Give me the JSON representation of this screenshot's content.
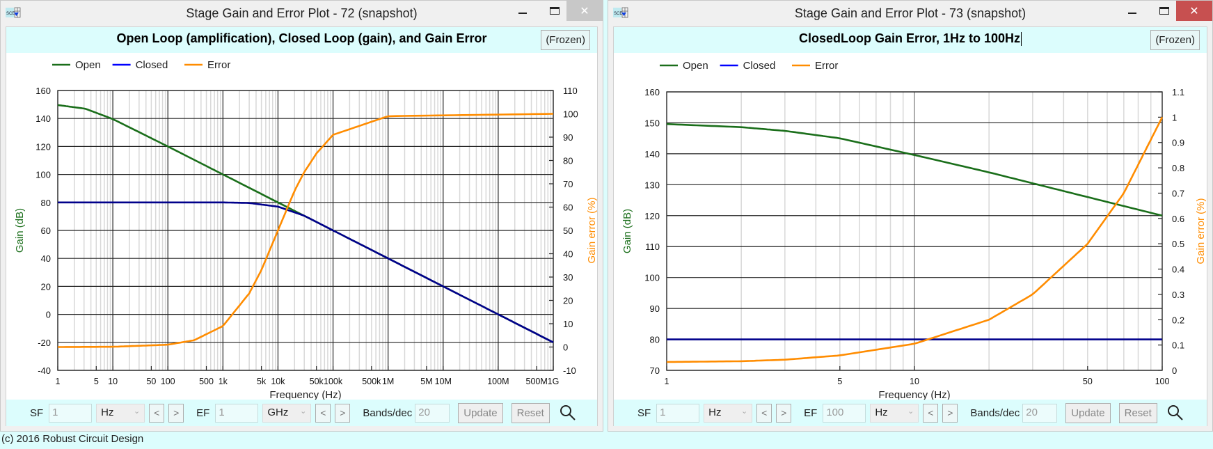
{
  "footer": "(c) 2016 Robust Circuit Design",
  "colors": {
    "open": "#1a6e1a",
    "closed": "#00008b",
    "error": "#ff8c00",
    "legend_closed": "#0000ff",
    "header_bg": "#dcfdfd"
  },
  "windows": [
    {
      "title": "Stage Gain and Error Plot - 72  (snapshot)",
      "chart_title": "Open Loop (amplification), Closed Loop (gain), and Gain Error",
      "frozen_label": "(Frozen)",
      "controls": {
        "sf_label": "SF",
        "sf_value": "1",
        "sf_unit": "Hz",
        "ef_label": "EF",
        "ef_value": "1",
        "ef_unit": "GHz",
        "prev": "<",
        "next": ">",
        "bands_label": "Bands/dec",
        "bands_value": "20",
        "update": "Update",
        "reset": "Reset"
      }
    },
    {
      "title": "Stage Gain and Error Plot - 73  (snapshot)",
      "chart_title": "ClosedLoop Gain Error, 1Hz to 100Hz",
      "frozen_label": "(Frozen)",
      "controls": {
        "sf_label": "SF",
        "sf_value": "1",
        "sf_unit": "Hz",
        "ef_label": "EF",
        "ef_value": "100",
        "ef_unit": "Hz",
        "prev": "<",
        "next": ">",
        "bands_label": "Bands/dec",
        "bands_value": "20",
        "update": "Update",
        "reset": "Reset"
      }
    }
  ],
  "chart_data": [
    {
      "type": "line",
      "title": "Open Loop (amplification), Closed Loop (gain), and Gain Error",
      "xlabel": "Frequency (Hz)",
      "ylabel": "Gain (dB)",
      "y2label": "Gain error (%)",
      "xscale": "log",
      "xlim": [
        1,
        1000000000
      ],
      "ylim": [
        -40,
        160
      ],
      "y2lim": [
        -10,
        110
      ],
      "yticks": [
        -40,
        -20,
        0,
        20,
        40,
        60,
        80,
        100,
        120,
        140,
        160
      ],
      "y2ticks": [
        -10,
        0,
        10,
        20,
        30,
        40,
        50,
        60,
        70,
        80,
        90,
        100,
        110
      ],
      "xtick_labels": [
        {
          "v": 1,
          "t": "1"
        },
        {
          "v": 5,
          "t": "5"
        },
        {
          "v": 10,
          "t": "10"
        },
        {
          "v": 50,
          "t": "50"
        },
        {
          "v": 100,
          "t": "100"
        },
        {
          "v": 500,
          "t": "500"
        },
        {
          "v": 1000,
          "t": "1k"
        },
        {
          "v": 5000,
          "t": "5k"
        },
        {
          "v": 10000,
          "t": "10k"
        },
        {
          "v": 50000,
          "t": "50k"
        },
        {
          "v": 100000,
          "t": "100k"
        },
        {
          "v": 500000,
          "t": "500k"
        },
        {
          "v": 1000000,
          "t": "1M"
        },
        {
          "v": 5000000,
          "t": "5M"
        },
        {
          "v": 10000000,
          "t": "10M"
        },
        {
          "v": 100000000,
          "t": "100M"
        },
        {
          "v": 500000000,
          "t": "500M"
        },
        {
          "v": 1000000000,
          "t": "1G"
        }
      ],
      "legend": [
        "Open",
        "Closed",
        "Error"
      ],
      "legend_position": "top-left",
      "grid": true,
      "series": [
        {
          "name": "Open",
          "axis": "left",
          "x": [
            1,
            3.16,
            10,
            100,
            1000,
            10000,
            100000,
            1000000,
            10000000,
            100000000,
            1000000000
          ],
          "y": [
            149.6,
            147,
            139.6,
            120,
            100,
            80,
            60,
            40,
            20,
            0,
            -20
          ]
        },
        {
          "name": "Closed",
          "axis": "left",
          "x": [
            1,
            100,
            1000,
            3000,
            10000,
            30000,
            100000,
            1000000,
            10000000,
            100000000,
            1000000000
          ],
          "y": [
            80,
            80,
            80,
            79.6,
            77,
            70.5,
            60,
            40,
            20,
            0,
            -20
          ]
        },
        {
          "name": "Error",
          "axis": "right",
          "x": [
            1,
            10,
            100,
            300,
            1000,
            3000,
            5000,
            10000,
            20000,
            30000,
            50000,
            100000,
            1000000,
            1000000000
          ],
          "y": [
            0,
            0.1,
            1,
            2.9,
            9,
            23,
            33,
            50,
            67,
            75,
            83,
            91,
            99,
            100
          ]
        }
      ]
    },
    {
      "type": "line",
      "title": "ClosedLoop Gain Error, 1Hz to 100Hz",
      "xlabel": "Frequency (Hz)",
      "ylabel": "Gain (dB)",
      "y2label": "Gain error (%)",
      "xscale": "log",
      "xlim": [
        1,
        100
      ],
      "ylim": [
        70,
        160
      ],
      "y2lim": [
        0,
        1.1
      ],
      "yticks": [
        70,
        80,
        90,
        100,
        110,
        120,
        130,
        140,
        150,
        160
      ],
      "y2ticks": [
        0,
        0.1,
        0.2,
        0.3,
        0.4,
        0.5,
        0.6,
        0.7,
        0.8,
        0.9,
        1,
        1.1
      ],
      "xtick_labels": [
        {
          "v": 1,
          "t": "1"
        },
        {
          "v": 5,
          "t": "5"
        },
        {
          "v": 10,
          "t": "10"
        },
        {
          "v": 50,
          "t": "50"
        },
        {
          "v": 100,
          "t": "100"
        }
      ],
      "legend": [
        "Open",
        "Closed",
        "Error"
      ],
      "legend_position": "top-left",
      "grid": true,
      "series": [
        {
          "name": "Open",
          "axis": "left",
          "x": [
            1,
            2,
            3,
            5,
            10,
            20,
            50,
            100
          ],
          "y": [
            149.6,
            148.6,
            147.4,
            145,
            139.6,
            134,
            126,
            120
          ]
        },
        {
          "name": "Closed",
          "axis": "left",
          "x": [
            1,
            100
          ],
          "y": [
            80,
            80
          ]
        },
        {
          "name": "Error",
          "axis": "right",
          "x": [
            1,
            2,
            3,
            5,
            10,
            20,
            30,
            50,
            70,
            100
          ],
          "y": [
            0.033,
            0.036,
            0.042,
            0.059,
            0.105,
            0.2,
            0.3,
            0.5,
            0.7,
            1.0
          ]
        }
      ]
    }
  ]
}
